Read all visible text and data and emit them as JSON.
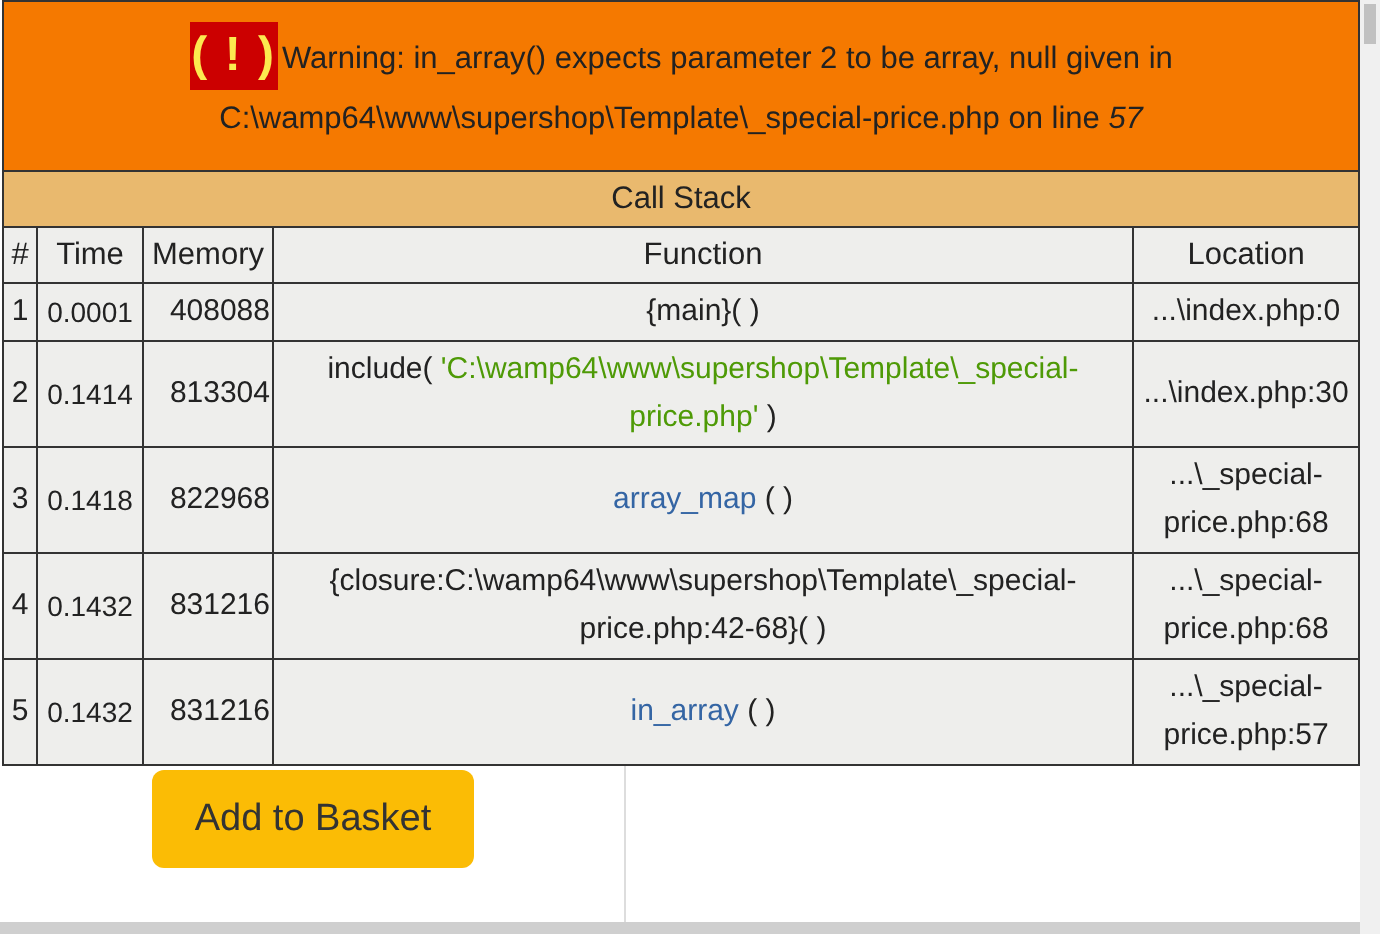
{
  "error": {
    "icon_text": "( ! )",
    "message_lines": [
      "Warning: in_array() expects parameter 2 to be array, null given in",
      "C:\\wamp64\\www\\supershop\\Template\\_special-price.php on line *57*"
    ]
  },
  "call_stack": {
    "title": "Call Stack",
    "columns": [
      "#",
      "Time",
      "Memory",
      "Function",
      "Location"
    ],
    "rows": [
      {
        "index": "1",
        "time": "0.0001",
        "memory": "408088",
        "function": [
          {
            "kind": "plain",
            "text": "{main}( )"
          }
        ],
        "location": "...\\index.php:0"
      },
      {
        "index": "2",
        "time": "0.1414",
        "memory": "813304",
        "function": [
          {
            "kind": "plain",
            "text": "include( "
          },
          {
            "kind": "string",
            "text": "'C:\\wamp64\\www\\supershop\\Template\\_special-price.php'"
          },
          {
            "kind": "plain",
            "text": " )"
          }
        ],
        "location": "...\\index.php:30"
      },
      {
        "index": "3",
        "time": "0.1418",
        "memory": "822968",
        "function": [
          {
            "kind": "link",
            "text": "array_map"
          },
          {
            "kind": "plain",
            "text": " ( )"
          }
        ],
        "location": "...\\_special-price.php:68"
      },
      {
        "index": "4",
        "time": "0.1432",
        "memory": "831216",
        "function": [
          {
            "kind": "plain",
            "text": "{closure:C:\\wamp64\\www\\supershop\\Template\\_special-price.php:42-68}( )"
          }
        ],
        "location": "...\\_special-price.php:68"
      },
      {
        "index": "5",
        "time": "0.1432",
        "memory": "831216",
        "function": [
          {
            "kind": "link",
            "text": "in_array"
          },
          {
            "kind": "plain",
            "text": " ( )"
          }
        ],
        "location": "...\\_special-price.php:57"
      }
    ]
  },
  "button": "Add to Basket"
}
